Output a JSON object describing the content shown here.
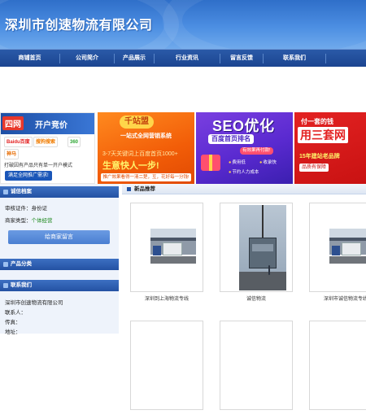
{
  "site": {
    "title": "深圳市创速物流有限公司"
  },
  "nav": {
    "items": [
      "商铺首页",
      "公司简介",
      "产品展示",
      "行业资讯",
      "留言反馈",
      "联系我们"
    ]
  },
  "banners": {
    "b1": {
      "brand": "四网",
      "headline": "开户竞价",
      "logos": [
        "Baidu百度",
        "搜狗搜索",
        "360",
        "神马"
      ],
      "tagline": "打破因有产品只有单一开户模式",
      "cta": "满足全网推广需求!"
    },
    "b2": {
      "title": "千站盟",
      "subtitle": "一站式全网营销系统",
      "line1": "3-7天关键词上百度首页1000+",
      "line2": "生意快人一步!",
      "strip": "推广效果看得一清二楚，互，花好每一分钱!"
    },
    "b3": {
      "title": "SEO优化",
      "subtitle": "百度首页排名",
      "badge": "有效果再付款!",
      "features": [
        "费用低",
        "收录快",
        "节约人力成本"
      ]
    },
    "b4": {
      "line1": "付一套的钱",
      "line2": "用三套网",
      "line3": "15年建站老品牌",
      "line4": "品质有保障"
    }
  },
  "sidebar": {
    "credentials_title": "诚信档案",
    "verify_label": "审核证件：身份证",
    "merchant_type_label": "商家类型：",
    "merchant_type_value": "个体经营",
    "contact_button": "给商家留言",
    "category_title": "产品分类",
    "contact_title": "联系我们",
    "company": "深圳市创速物流有限公司",
    "contact_person": "联系人：",
    "fax": "传真：",
    "address": "地址："
  },
  "content": {
    "title": "新品推荐",
    "products": [
      {
        "caption": "深圳到上海物流专线",
        "icon": "truck-photo"
      },
      {
        "caption": "诚信物流",
        "icon": "crane-photo"
      },
      {
        "caption": "深圳市诚信物流专线",
        "icon": "truck-photo"
      }
    ]
  },
  "colors": {
    "header_blue": "#4c8ee2",
    "nav_blue": "#1b4590",
    "sidebar_bg": "#eef3fb",
    "merchant_type_green": "#228b22"
  }
}
